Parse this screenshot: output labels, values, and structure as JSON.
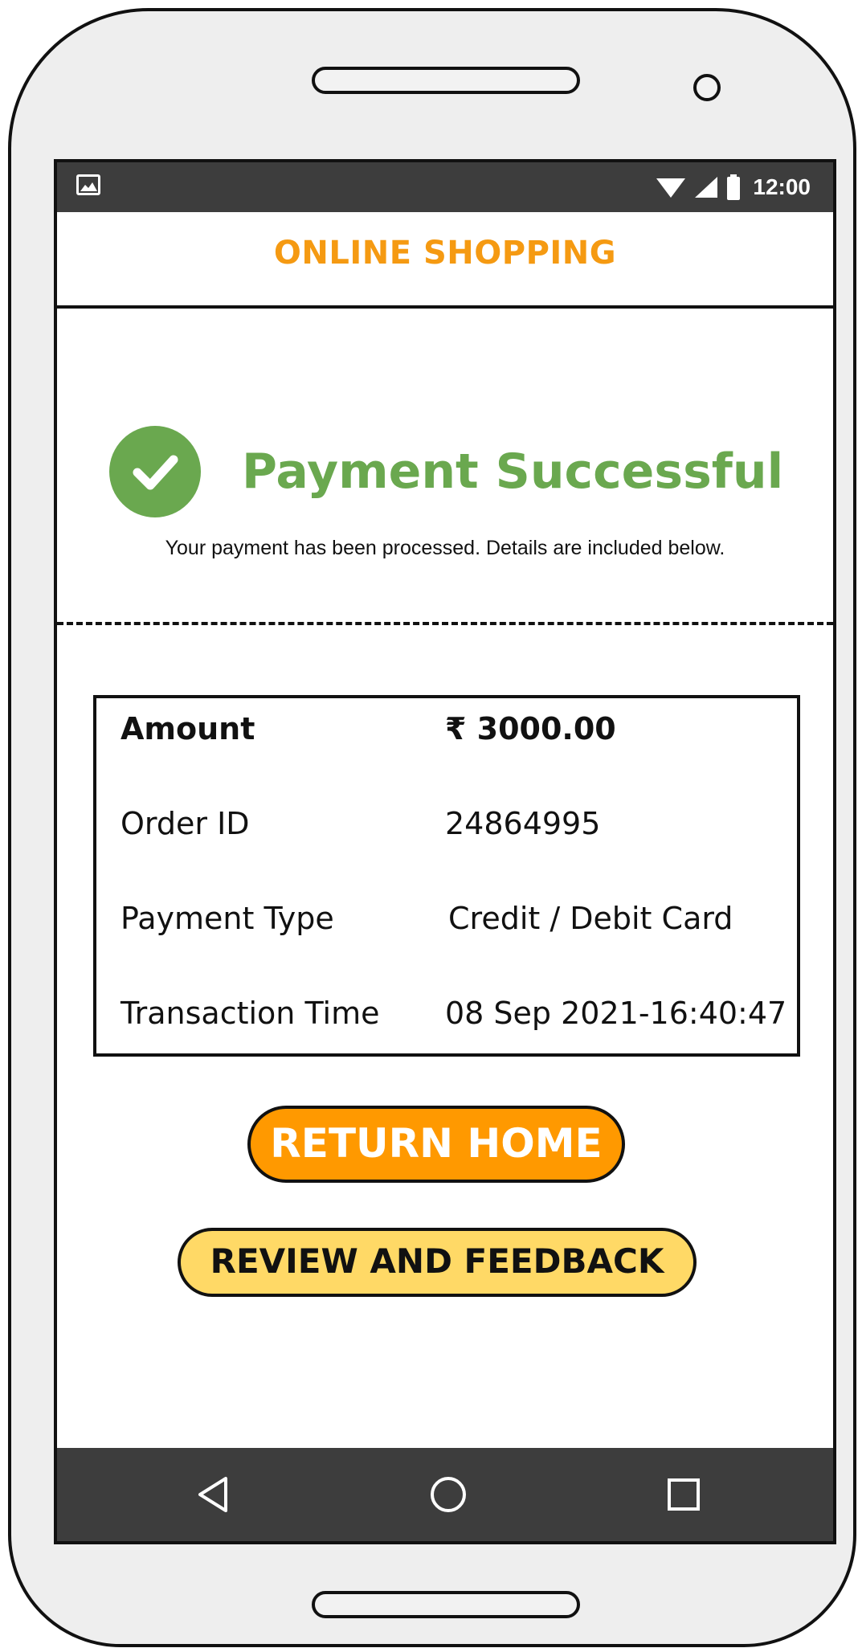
{
  "status_bar": {
    "time": "12:00"
  },
  "app_bar": {
    "title": "ONLINE SHOPPING"
  },
  "confirmation": {
    "title": "Payment Successful",
    "subtitle": "Your payment has been processed. Details are included below."
  },
  "details": {
    "amount": {
      "label": "Amount",
      "value": "₹ 3000.00"
    },
    "order_id": {
      "label": "Order ID",
      "value": "24864995"
    },
    "payment_type": {
      "label": "Payment Type",
      "value": "Credit / Debit Card"
    },
    "transaction_time": {
      "label": "Transaction Time",
      "value": "08 Sep 2021-16:40:47"
    }
  },
  "buttons": {
    "return_home": "RETURN HOME",
    "review_feedback": "REVIEW AND FEEDBACK"
  },
  "colors": {
    "accent": "#f59a12",
    "success": "#6aa84f",
    "primary_button": "#ff9900",
    "secondary_button": "#ffd966",
    "system_bars": "#3d3d3d"
  },
  "icons": {
    "status": [
      "image-icon",
      "wifi-icon",
      "signal-icon",
      "battery-icon"
    ],
    "navigation": [
      "back-icon",
      "home-icon",
      "recents-icon"
    ],
    "confirmation": "check-circle-icon"
  }
}
